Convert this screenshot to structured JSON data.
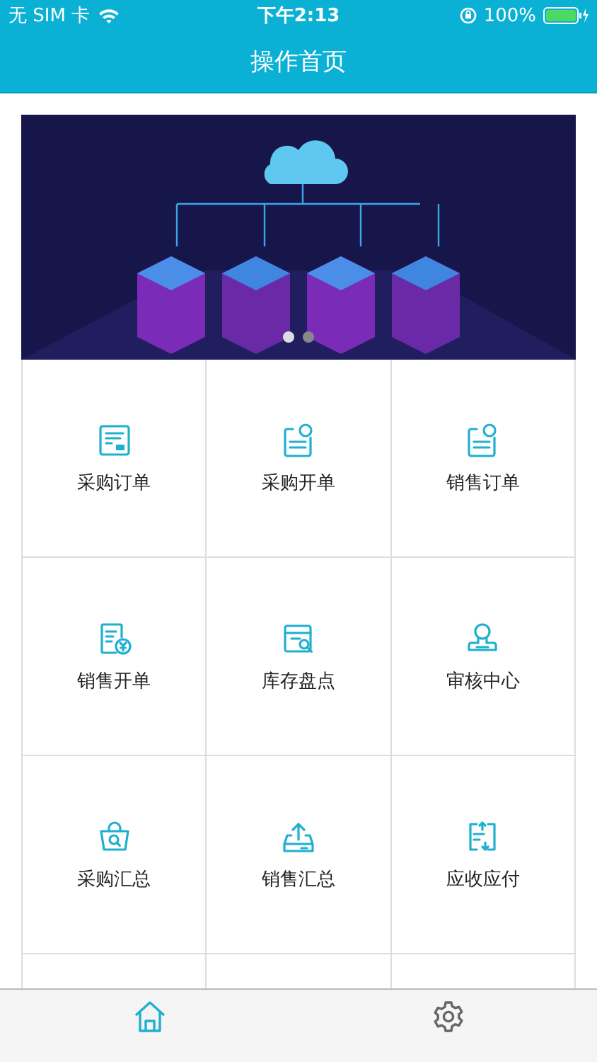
{
  "status_bar": {
    "carrier": "无 SIM 卡",
    "time": "下午2:13",
    "battery": "100%"
  },
  "nav_bar": {
    "title": "操作首页"
  },
  "banner": {
    "dots": [
      {
        "selected": true
      },
      {
        "selected": false
      }
    ]
  },
  "tiles": [
    {
      "label": "采购订单"
    },
    {
      "label": "采购开单"
    },
    {
      "label": "销售订单"
    },
    {
      "label": "销售开单"
    },
    {
      "label": "库存盘点"
    },
    {
      "label": "审核中心"
    },
    {
      "label": "采购汇总"
    },
    {
      "label": "销售汇总"
    },
    {
      "label": "应收应付"
    }
  ],
  "tab_bar": [
    {
      "selected": true
    },
    {
      "selected": false
    }
  ]
}
